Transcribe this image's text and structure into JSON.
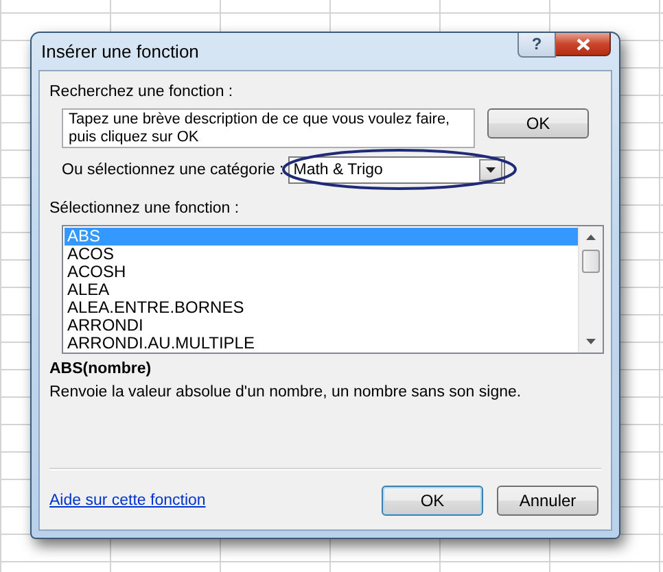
{
  "window": {
    "title": "Insérer une fonction",
    "help_button": "?"
  },
  "search": {
    "label": "Recherchez une fonction :",
    "value": "Tapez une brève description de ce que vous voulez faire, puis cliquez sur OK",
    "button": "OK"
  },
  "category": {
    "label": "Ou sélectionnez une catégorie :",
    "value": "Math & Trigo",
    "highlighted": true
  },
  "functions": {
    "label": "Sélectionnez une fonction :",
    "items": [
      {
        "name": "ABS",
        "selected": true
      },
      {
        "name": "ACOS",
        "selected": false
      },
      {
        "name": "ACOSH",
        "selected": false
      },
      {
        "name": "ALEA",
        "selected": false
      },
      {
        "name": "ALEA.ENTRE.BORNES",
        "selected": false
      },
      {
        "name": "ARRONDI",
        "selected": false
      },
      {
        "name": "ARRONDI.AU.MULTIPLE",
        "selected": false
      }
    ]
  },
  "signature": "ABS(nombre)",
  "description": "Renvoie la valeur absolue d'un nombre, un nombre sans son signe.",
  "help_link": "Aide sur cette fonction",
  "buttons": [
    {
      "label": "OK",
      "default": true
    },
    {
      "label": "Annuler",
      "default": false
    }
  ]
}
